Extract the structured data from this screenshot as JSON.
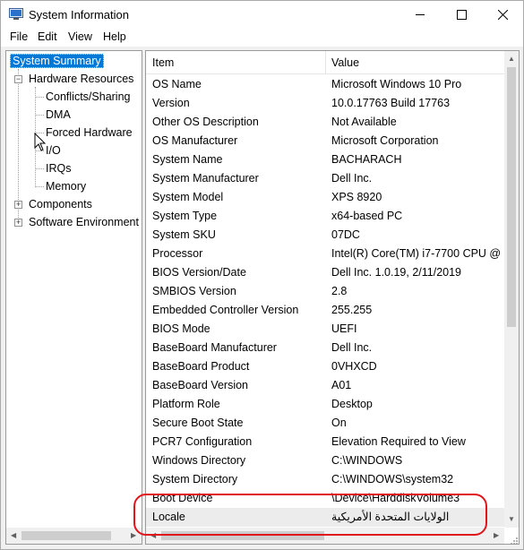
{
  "window": {
    "title": "System Information"
  },
  "menu": [
    "File",
    "Edit",
    "View",
    "Help"
  ],
  "tree": {
    "root": "System Summary",
    "hardware": "Hardware Resources",
    "hardware_children": [
      "Conflicts/Sharing",
      "DMA",
      "Forced Hardware",
      "I/O",
      "IRQs",
      "Memory"
    ],
    "components": "Components",
    "software": "Software Environment"
  },
  "list": {
    "headers": {
      "item": "Item",
      "value": "Value"
    },
    "rows": [
      {
        "item": "OS Name",
        "value": "Microsoft Windows 10 Pro"
      },
      {
        "item": "Version",
        "value": "10.0.17763 Build 17763"
      },
      {
        "item": "Other OS Description",
        "value": "Not Available"
      },
      {
        "item": "OS Manufacturer",
        "value": "Microsoft Corporation"
      },
      {
        "item": "System Name",
        "value": "BACHARACH"
      },
      {
        "item": "System Manufacturer",
        "value": "Dell Inc."
      },
      {
        "item": "System Model",
        "value": "XPS 8920"
      },
      {
        "item": "System Type",
        "value": "x64-based PC"
      },
      {
        "item": "System SKU",
        "value": "07DC"
      },
      {
        "item": "Processor",
        "value": "Intel(R) Core(TM) i7-7700 CPU @"
      },
      {
        "item": "BIOS Version/Date",
        "value": "Dell Inc. 1.0.19, 2/11/2019"
      },
      {
        "item": "SMBIOS Version",
        "value": "2.8"
      },
      {
        "item": "Embedded Controller Version",
        "value": "255.255"
      },
      {
        "item": "BIOS Mode",
        "value": "UEFI"
      },
      {
        "item": "BaseBoard Manufacturer",
        "value": "Dell Inc."
      },
      {
        "item": "BaseBoard Product",
        "value": "0VHXCD"
      },
      {
        "item": "BaseBoard Version",
        "value": "A01"
      },
      {
        "item": "Platform Role",
        "value": "Desktop"
      },
      {
        "item": "Secure Boot State",
        "value": "On"
      },
      {
        "item": "PCR7 Configuration",
        "value": "Elevation Required to View"
      },
      {
        "item": "Windows Directory",
        "value": "C:\\WINDOWS"
      },
      {
        "item": "System Directory",
        "value": "C:\\WINDOWS\\system32"
      },
      {
        "item": "Boot Device",
        "value": "\\Device\\HarddiskVolume3"
      },
      {
        "item": "Locale",
        "value": "الولايات المتحدة الأمريكية"
      }
    ]
  },
  "colors": {
    "selection": "#0078d7",
    "annotation": "#e0161d"
  }
}
